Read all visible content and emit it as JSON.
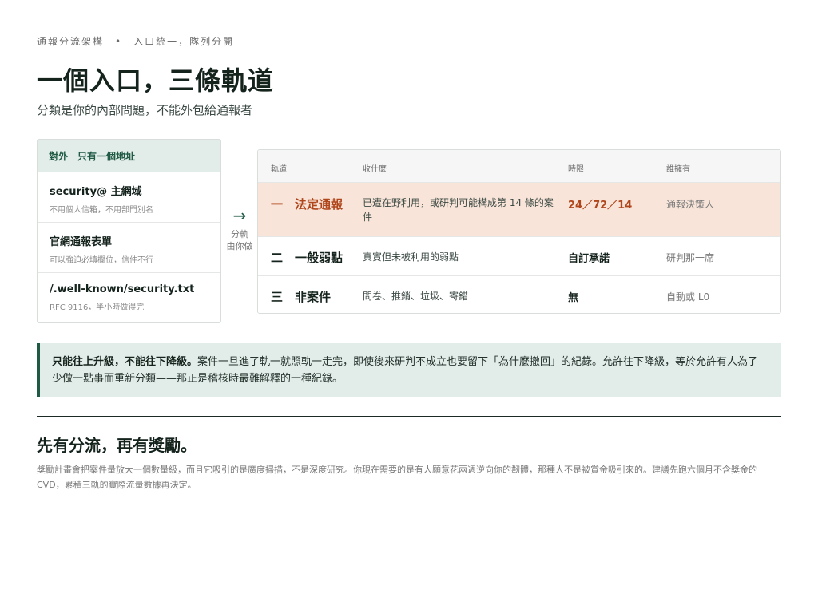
{
  "eyebrow": {
    "left": "通報分流架構",
    "dot": "•",
    "right": "入口統一，隊列分開"
  },
  "title": "一個入口，三條軌道",
  "subtitle": "分類是你的內部問題，不能外包給通報者",
  "intake": {
    "head_tag": "對外",
    "head_text": "只有一個地址",
    "items": [
      {
        "title": "security@ 主網域",
        "desc": "不用個人信箱，不用部門別名"
      },
      {
        "title": "官網通報表單",
        "desc": "可以強迫必填欄位，信件不行"
      },
      {
        "title": "/.well-known/security.txt",
        "desc": "RFC 9116，半小時做得完"
      }
    ]
  },
  "route": {
    "arrow": "→",
    "label_1": "分軌",
    "label_2": "由你做"
  },
  "tracks": {
    "headers": {
      "track": "軌道",
      "what": "收什麼",
      "time": "時限",
      "owner": "誰擁有"
    },
    "rows": [
      {
        "num": "一",
        "name": "法定通報",
        "what": "已遭在野利用，或研判可能構成第 14 條的案件",
        "time": "24／72／14",
        "owner": "通報決策人"
      },
      {
        "num": "二",
        "name": "一般弱點",
        "what": "真實但未被利用的弱點",
        "time": "自訂承諾",
        "owner": "研判那一席"
      },
      {
        "num": "三",
        "name": "非案件",
        "what": "問卷、推銷、垃圾、寄錯",
        "time": "無",
        "owner": "自動或 L0"
      }
    ]
  },
  "callout": {
    "bold": "只能往上升級，不能往下降級。",
    "text": "案件一旦進了軌一就照軌一走完，即使後來研判不成立也要留下「為什麼撤回」的紀錄。允許往下降級，等於允許有人為了少做一點事而重新分類——那正是稽核時最難解釋的一種紀錄。"
  },
  "section": {
    "heading": "先有分流，再有獎勵。",
    "body": "獎勵計畫會把案件量放大一個數量級，而且它吸引的是廣度掃描，不是深度研究。你現在需要的是有人願意花兩週逆向你的韌體，那種人不是被賞金吸引來的。建議先跑六個月不含獎金的 CVD，累積三軌的實際流量數據再決定。"
  },
  "colors": {
    "accent": "#1f5a45",
    "legal": "#b0461c",
    "legal_bg": "#f8e4d8",
    "callout_bg": "#e2ece8"
  }
}
